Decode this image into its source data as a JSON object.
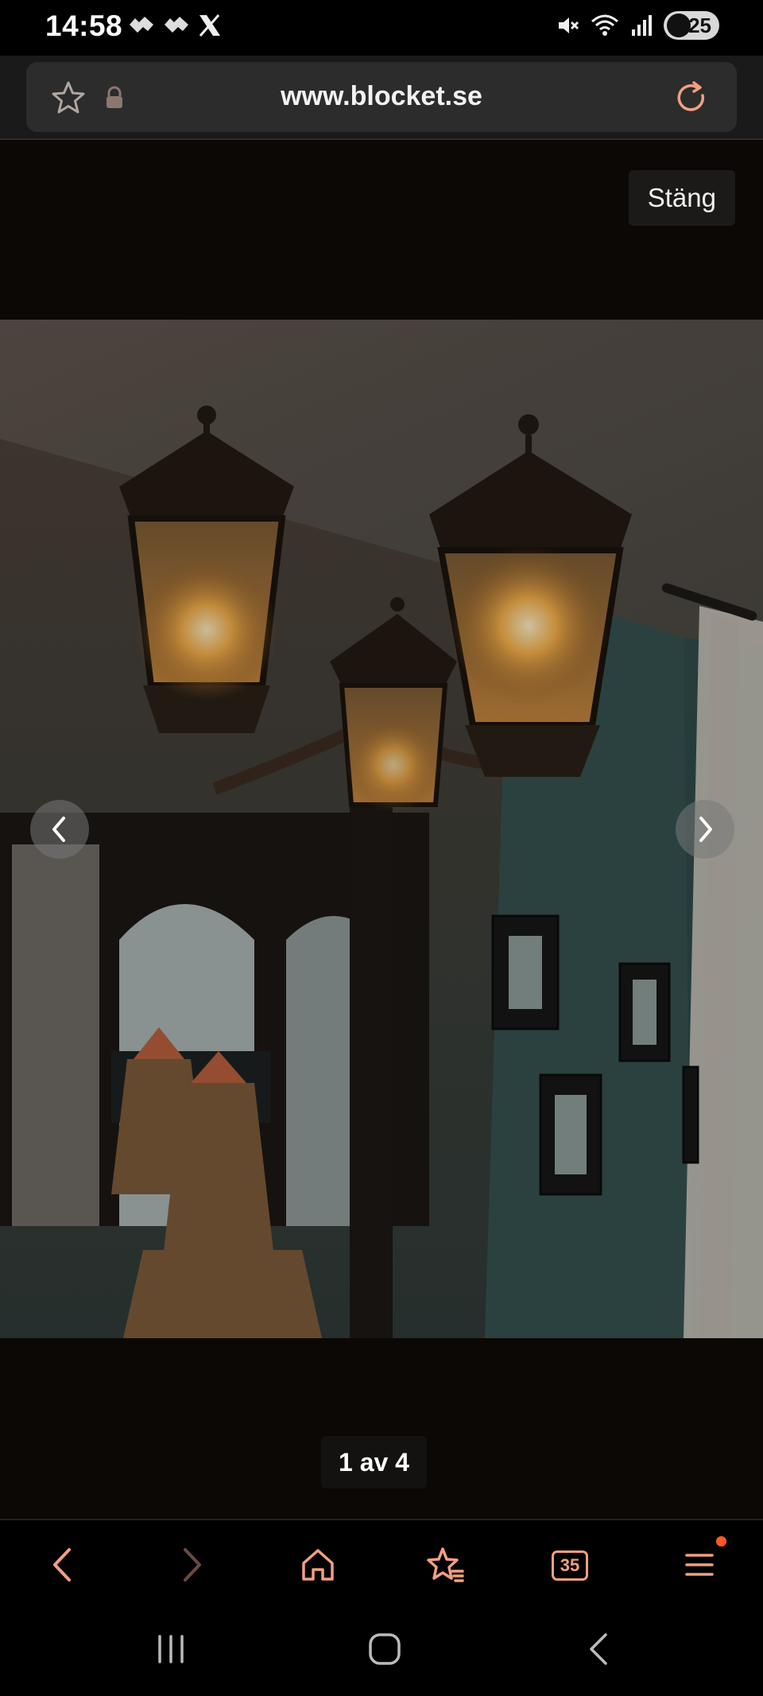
{
  "status_bar": {
    "time": "14:58",
    "battery_level": "25",
    "notification_icons": [
      "messenger-like-icon",
      "messenger-like-icon",
      "x-logo-icon"
    ],
    "system_icons": [
      "mute-icon",
      "wifi-icon",
      "signal-icon",
      "battery-icon"
    ]
  },
  "browser": {
    "url": "www.blocket.se",
    "tab_count": "35"
  },
  "viewer": {
    "close_label": "Stäng",
    "counter": "1 av 4",
    "current_image": 1,
    "total_images": 4
  },
  "colors": {
    "accent": "#f0a080",
    "notification_dot": "#ff5a1f",
    "background": "#0b0908"
  }
}
